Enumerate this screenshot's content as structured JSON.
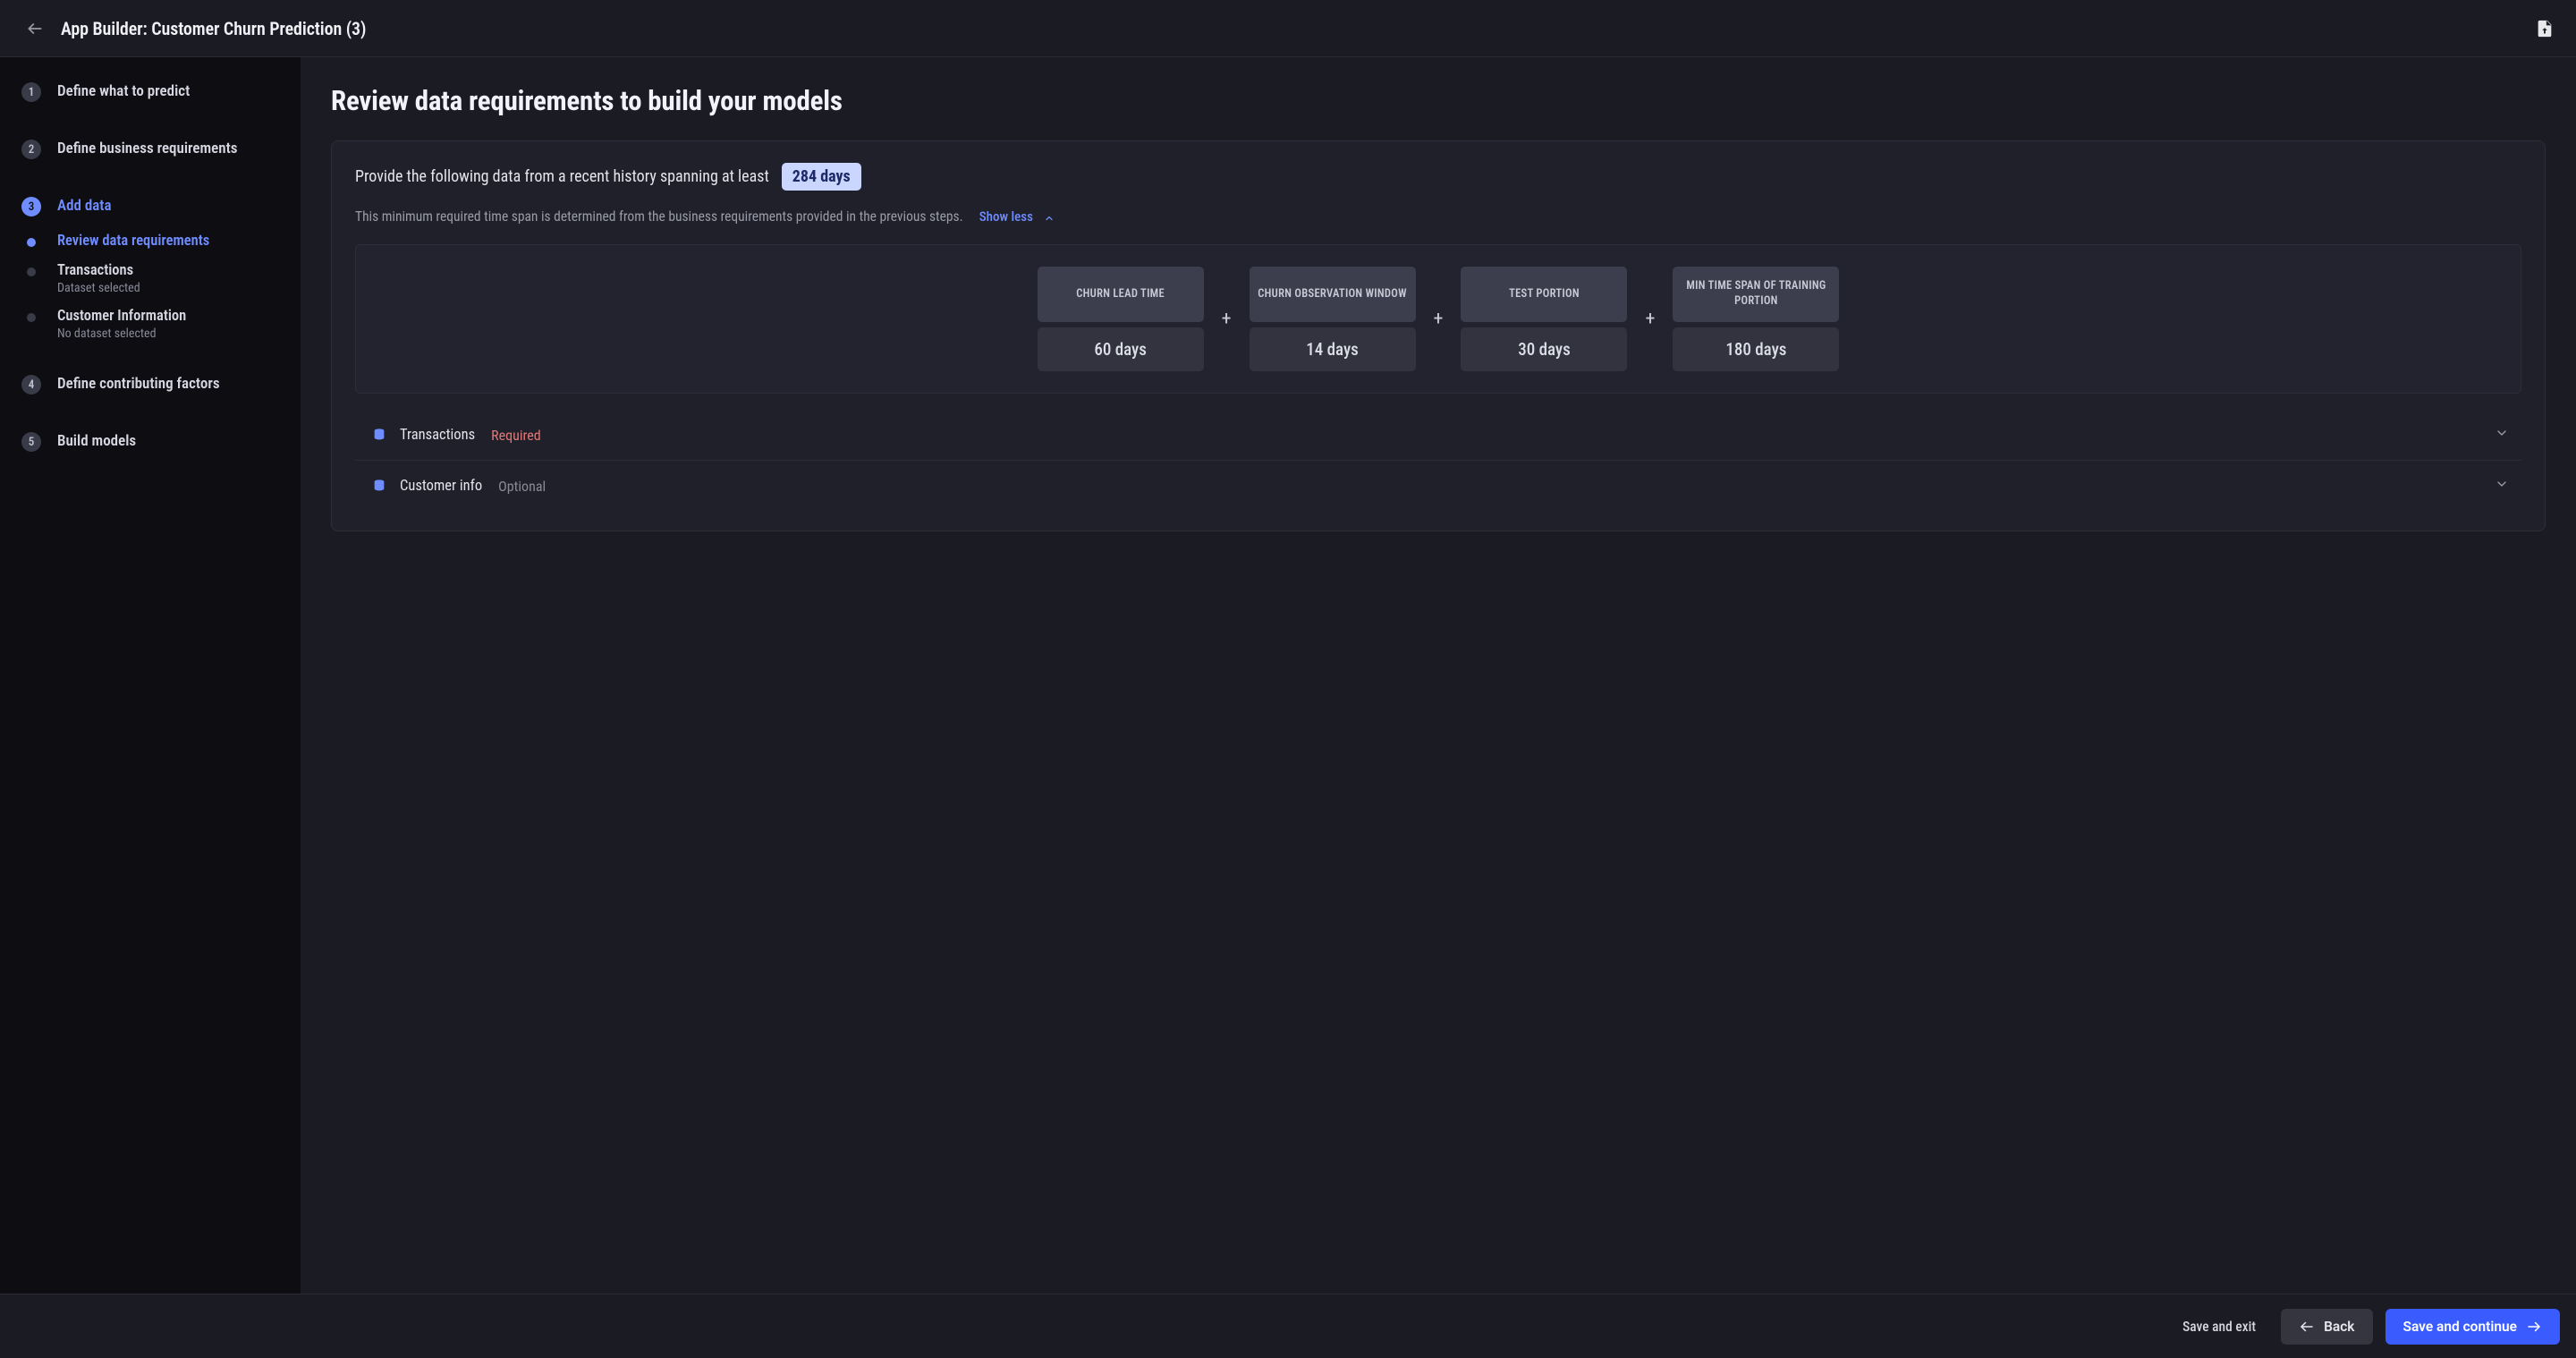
{
  "header": {
    "title": "App Builder: Customer Churn Prediction (3)"
  },
  "sidebar": {
    "steps": [
      {
        "label": "Define what to predict"
      },
      {
        "label": "Define business requirements"
      },
      {
        "label": "Add data"
      },
      {
        "label": "Define contributing factors"
      },
      {
        "label": "Build models"
      }
    ],
    "substeps": [
      {
        "title": "Review data requirements"
      },
      {
        "title": "Transactions",
        "subtitle": "Dataset selected"
      },
      {
        "title": "Customer Information",
        "subtitle": "No dataset selected"
      }
    ]
  },
  "main": {
    "title": "Review data requirements to build your models",
    "intro_text": "Provide the following data from a recent history spanning at least",
    "badge": "284 days",
    "subline": "This minimum required time span is determined from the business requirements provided in the previous steps.",
    "show_less": "Show less",
    "terms": [
      {
        "label": "CHURN LEAD TIME",
        "value": "60 days"
      },
      {
        "label": "CHURN OBSERVATION WINDOW",
        "value": "14 days"
      },
      {
        "label": "TEST PORTION",
        "value": "30 days"
      },
      {
        "label": "MIN TIME SPAN OF TRAINING PORTION",
        "value": "180 days"
      }
    ],
    "datasets": [
      {
        "name": "Transactions",
        "tag": "Required",
        "tag_type": "req"
      },
      {
        "name": "Customer info",
        "tag": "Optional",
        "tag_type": "opt"
      }
    ]
  },
  "footer": {
    "save_exit": "Save and exit",
    "back": "Back",
    "save_continue": "Save and continue"
  }
}
